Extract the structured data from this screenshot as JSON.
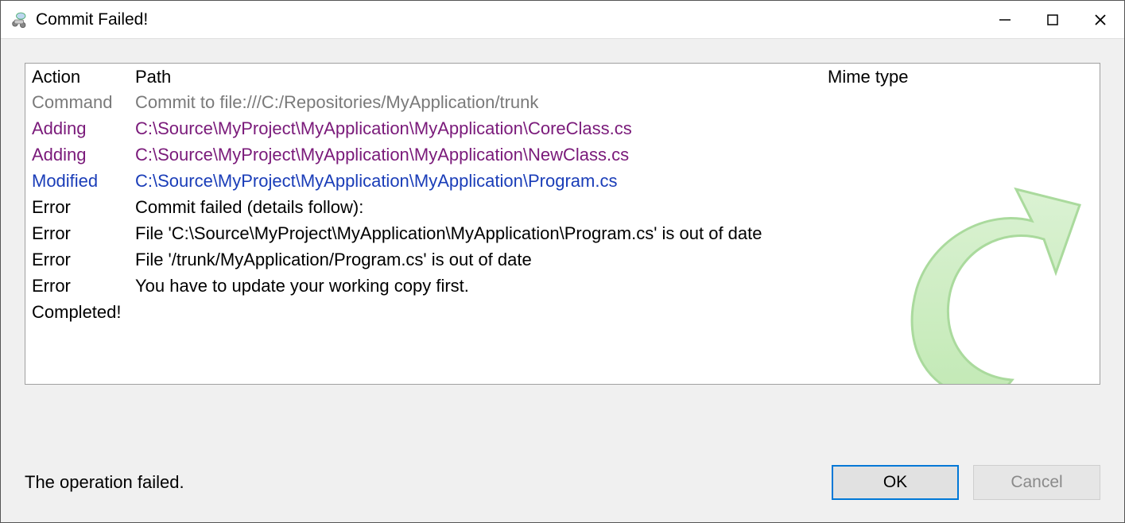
{
  "titlebar": {
    "title": "Commit Failed!"
  },
  "columns": {
    "action": "Action",
    "path": "Path",
    "mime": "Mime type"
  },
  "rows": [
    {
      "action": "Command",
      "path": "Commit to file:///C:/Repositories/MyApplication/trunk",
      "style": "command"
    },
    {
      "action": "Adding",
      "path": "C:\\Source\\MyProject\\MyApplication\\MyApplication\\CoreClass.cs",
      "style": "adding"
    },
    {
      "action": "Adding",
      "path": "C:\\Source\\MyProject\\MyApplication\\MyApplication\\NewClass.cs",
      "style": "adding"
    },
    {
      "action": "Modified",
      "path": "C:\\Source\\MyProject\\MyApplication\\MyApplication\\Program.cs",
      "style": "modified"
    },
    {
      "action": "Error",
      "path": "Commit failed (details follow):",
      "style": "error"
    },
    {
      "action": "Error",
      "path": "File 'C:\\Source\\MyProject\\MyApplication\\MyApplication\\Program.cs' is out of date",
      "style": "error"
    },
    {
      "action": "Error",
      "path": "File '/trunk/MyApplication/Program.cs' is out of date",
      "style": "error"
    },
    {
      "action": "Error",
      "path": "You have to update your working copy first.",
      "style": "error"
    },
    {
      "action": "Completed!",
      "path": "",
      "style": "completed"
    }
  ],
  "footer": {
    "status": "The operation failed.",
    "ok": "OK",
    "cancel": "Cancel"
  }
}
